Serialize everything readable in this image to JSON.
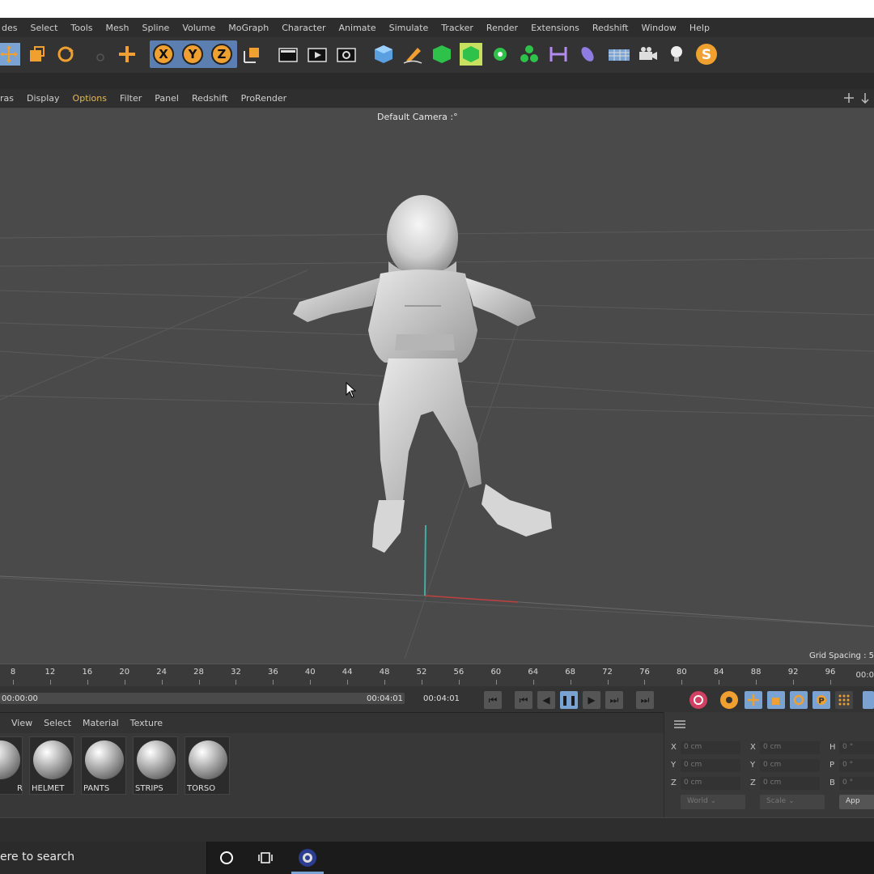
{
  "menubar": {
    "items": [
      "des",
      "Select",
      "Tools",
      "Mesh",
      "Spline",
      "Volume",
      "MoGraph",
      "Character",
      "Animate",
      "Simulate",
      "Tracker",
      "Render",
      "Extensions",
      "Redshift",
      "Window",
      "Help"
    ]
  },
  "toolbar": {
    "axis_x": "X",
    "axis_y": "Y",
    "axis_z": "Z",
    "plugin_letter": "S",
    "icons": [
      "move-icon",
      "scale-icon",
      "rotate-icon",
      "live-select-icon",
      "add-icon",
      "axis-x-icon",
      "axis-y-icon",
      "axis-z-icon",
      "coordinate-system-icon",
      "render-view-icon",
      "render-picture-viewer-icon",
      "render-settings-icon",
      "cube-icon",
      "pen-icon",
      "subdivision-icon",
      "generator-icon",
      "mograph-icon",
      "cloner-icon",
      "deformer-icon",
      "sculpt-icon",
      "floor-icon",
      "camera-icon",
      "light-icon",
      "plugin-icon"
    ]
  },
  "viewmenu": {
    "items": [
      "ras",
      "Display",
      "Options",
      "Filter",
      "Panel",
      "Redshift",
      "ProRender"
    ]
  },
  "viewport": {
    "camera_label": "Default Camera",
    "camera_suffix": ":°",
    "grid_spacing": "Grid Spacing : 5"
  },
  "timeline": {
    "ticks": [
      "8",
      "12",
      "16",
      "20",
      "24",
      "28",
      "32",
      "36",
      "40",
      "44",
      "48",
      "52",
      "56",
      "60",
      "64",
      "68",
      "72",
      "76",
      "80",
      "84",
      "88",
      "92",
      "96"
    ],
    "ruler_end": "00:0",
    "start_time": "00:00:00",
    "end_time": "00:04:01",
    "current_time": "00:04:01"
  },
  "material_manager": {
    "menu": [
      "View",
      "Select",
      "Material",
      "Texture"
    ],
    "materials": [
      {
        "name": "R"
      },
      {
        "name": "HELMET"
      },
      {
        "name": "PANTS"
      },
      {
        "name": "STRIPS"
      },
      {
        "name": "TORSO"
      }
    ]
  },
  "coordinates": {
    "pos_labels": [
      "X",
      "Y",
      "Z"
    ],
    "size_labels": [
      "X",
      "Y",
      "Z"
    ],
    "rot_labels": [
      "H",
      "P",
      "B"
    ],
    "pos_values": [
      "0 cm",
      "0 cm",
      "0 cm"
    ],
    "size_values": [
      "0 cm",
      "0 cm",
      "0 cm"
    ],
    "rot_values": [
      "0 °",
      "0 °",
      "0 °"
    ],
    "world_dropdown": "World",
    "scale_dropdown": "Scale",
    "apply_label": "App"
  },
  "taskbar": {
    "search_text": "ere to search"
  },
  "colors": {
    "accent_orange": "#f0a030",
    "accent_blue": "#7aa3d4",
    "viewport_bg": "#4a4a4a"
  }
}
